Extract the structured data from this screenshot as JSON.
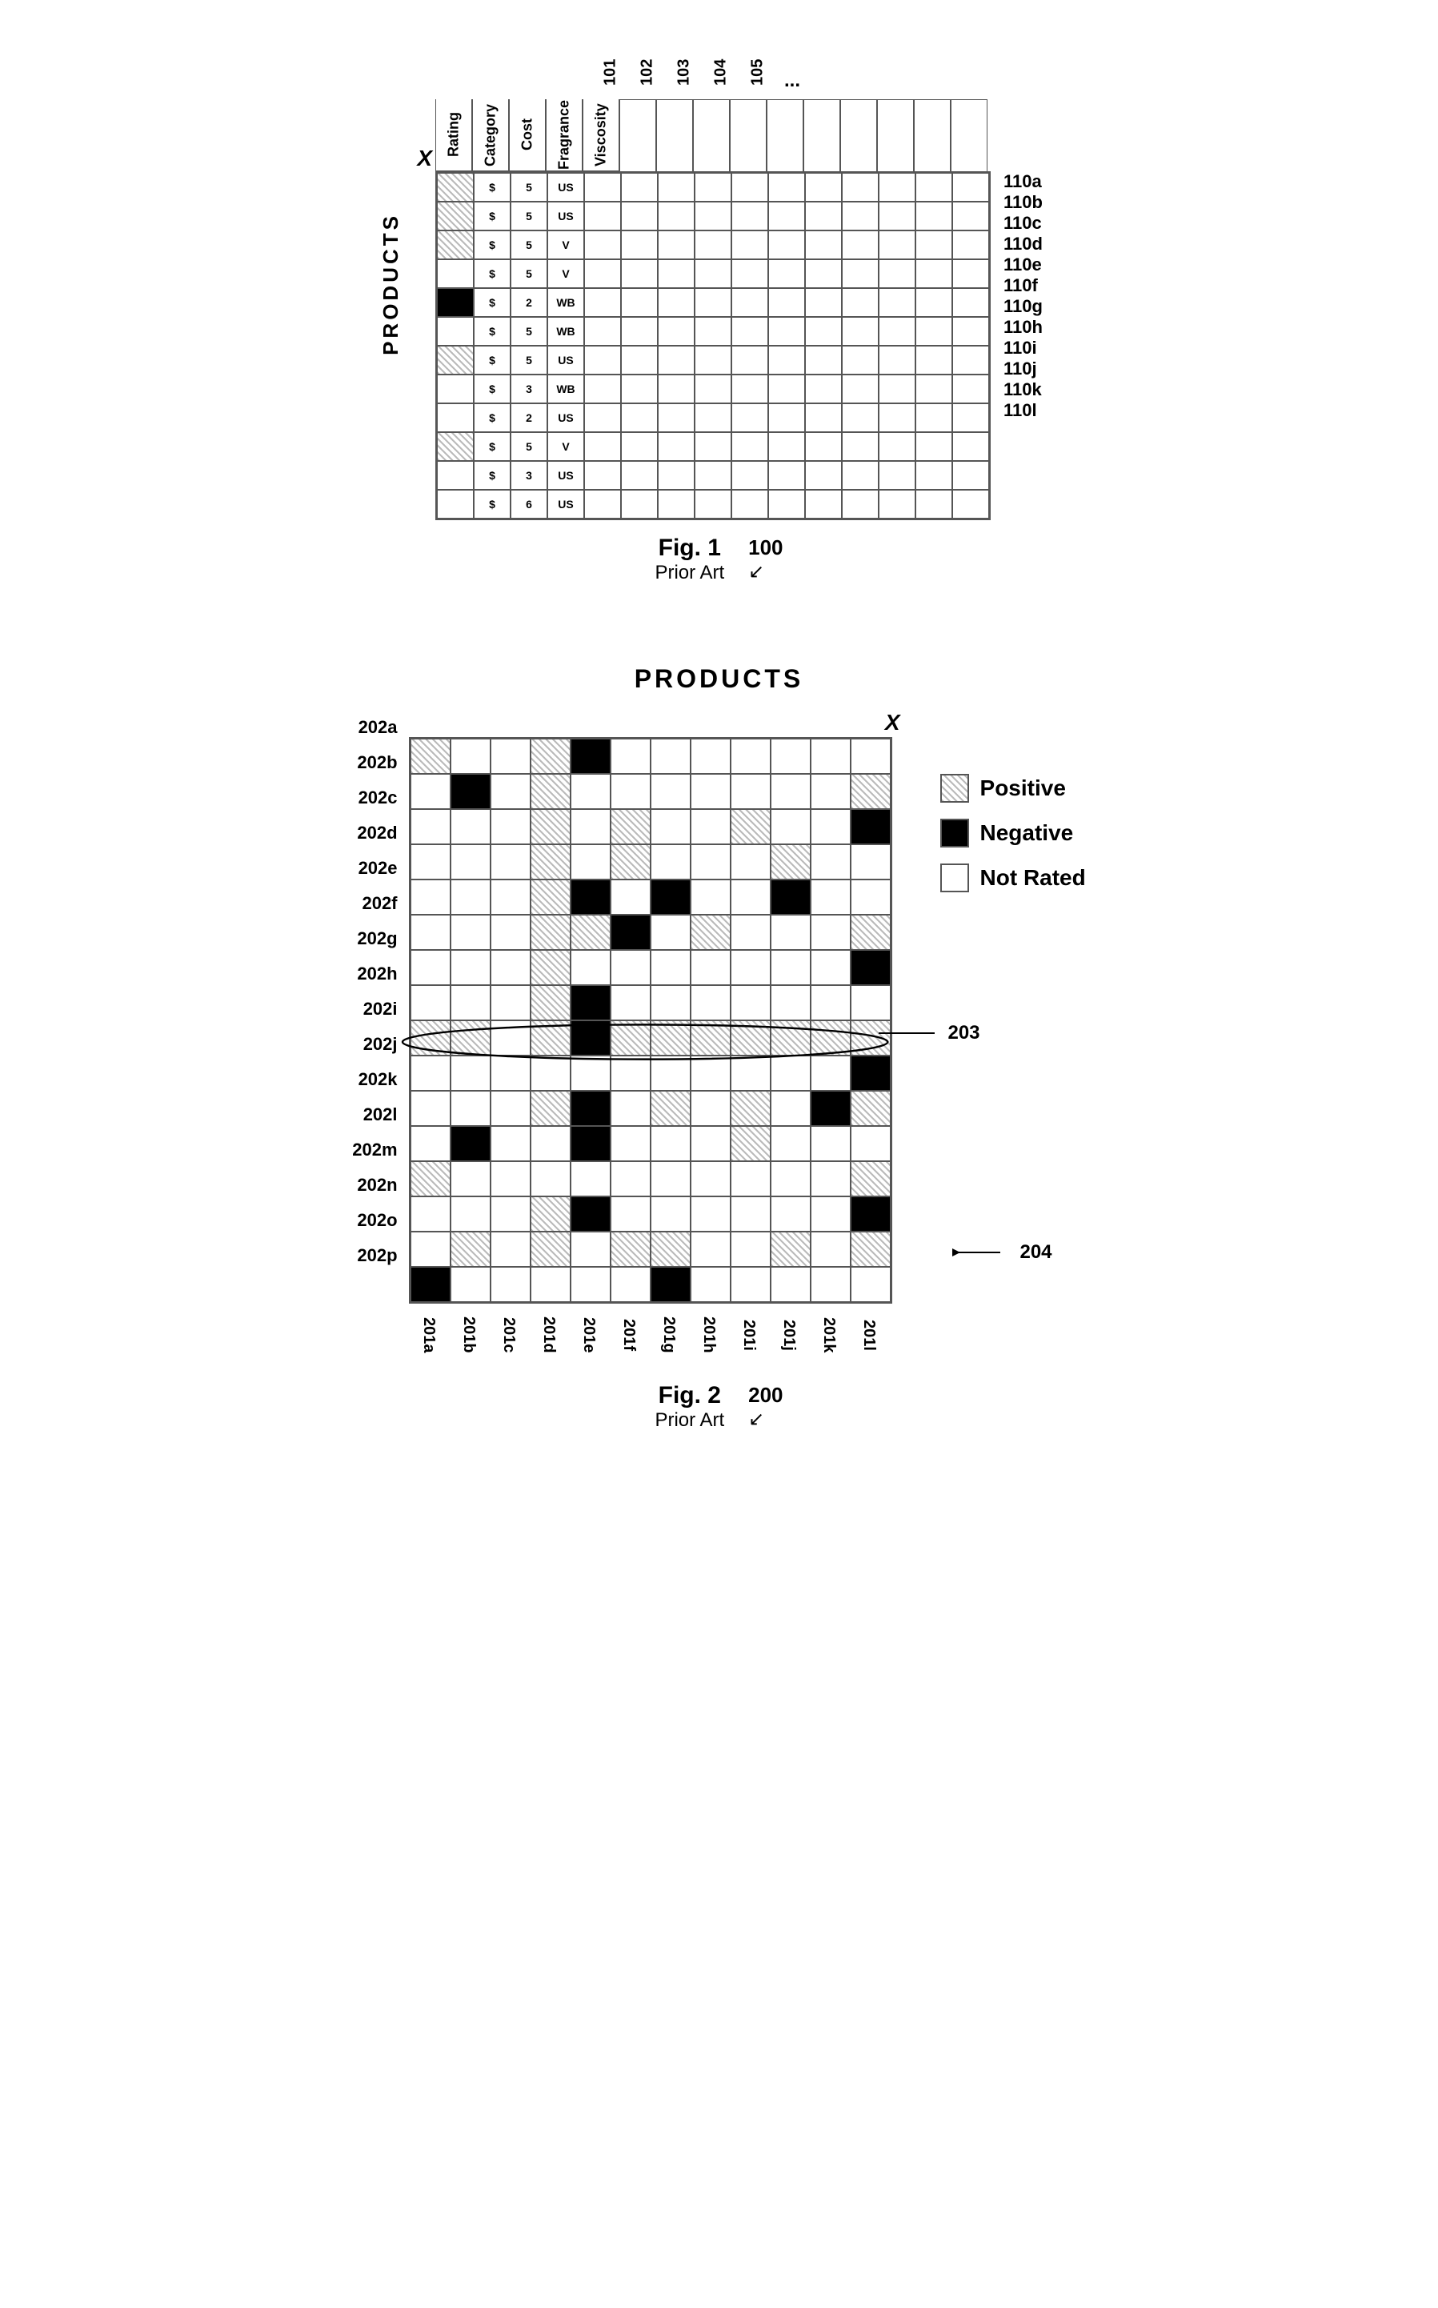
{
  "fig1": {
    "title": "Fig. 1",
    "subtitle": "Prior Art",
    "ref": "100",
    "products_label": "PRODUCTS",
    "x_label": "X",
    "col_numbers": [
      "101",
      "102",
      "103",
      "104",
      "105"
    ],
    "ellipsis": "...",
    "attr_headers": [
      "Rating",
      "Category",
      "Cost",
      "Fragrance",
      "Viscosity"
    ],
    "row_labels": [
      "110a",
      "110b",
      "110c",
      "110d",
      "110e",
      "110f",
      "110g",
      "110h",
      "110i",
      "110j",
      "110k",
      "110l"
    ],
    "rows": [
      [
        "hatched",
        "text",
        "text",
        "text",
        "white",
        "white",
        "white",
        "white",
        "white",
        "white",
        "white",
        "white",
        "white",
        "white",
        "white"
      ],
      [
        "hatched",
        "text",
        "text",
        "text",
        "white",
        "white",
        "white",
        "white",
        "white",
        "white",
        "white",
        "white",
        "white",
        "white",
        "white"
      ],
      [
        "hatched",
        "text",
        "text",
        "text",
        "white",
        "white",
        "white",
        "white",
        "white",
        "white",
        "white",
        "white",
        "white",
        "white",
        "white"
      ],
      [
        "white",
        "text",
        "text",
        "text",
        "white",
        "white",
        "white",
        "white",
        "white",
        "white",
        "white",
        "white",
        "white",
        "white",
        "white"
      ],
      [
        "black",
        "text",
        "text",
        "text",
        "white",
        "white",
        "white",
        "white",
        "white",
        "white",
        "white",
        "white",
        "white",
        "white",
        "white"
      ],
      [
        "white",
        "text",
        "text",
        "text",
        "white",
        "white",
        "white",
        "white",
        "white",
        "white",
        "white",
        "white",
        "white",
        "white",
        "white"
      ],
      [
        "hatched",
        "text",
        "text",
        "text",
        "white",
        "white",
        "white",
        "white",
        "white",
        "white",
        "white",
        "white",
        "white",
        "white",
        "white"
      ],
      [
        "white",
        "text",
        "text",
        "text",
        "white",
        "white",
        "white",
        "white",
        "white",
        "white",
        "white",
        "white",
        "white",
        "white",
        "white"
      ],
      [
        "white",
        "text",
        "text",
        "text",
        "white",
        "white",
        "white",
        "white",
        "white",
        "white",
        "white",
        "white",
        "white",
        "white",
        "white"
      ],
      [
        "hatched",
        "text",
        "text",
        "text",
        "white",
        "white",
        "white",
        "white",
        "white",
        "white",
        "white",
        "white",
        "white",
        "white",
        "white"
      ],
      [
        "white",
        "text",
        "text",
        "text",
        "white",
        "white",
        "white",
        "white",
        "white",
        "white",
        "white",
        "white",
        "white",
        "white",
        "white"
      ],
      [
        "white",
        "text",
        "text",
        "text",
        "white",
        "white",
        "white",
        "white",
        "white",
        "white",
        "white",
        "white",
        "white",
        "white",
        "white"
      ]
    ],
    "cell_texts": [
      [
        "",
        "$",
        "5",
        "US"
      ],
      [
        "",
        "$",
        "5",
        "US"
      ],
      [
        "",
        "$",
        "5",
        "V"
      ],
      [
        "",
        "$",
        "5",
        "V"
      ],
      [
        "",
        "$",
        "2",
        "WB"
      ],
      [
        "",
        "$",
        "5",
        "WB"
      ],
      [
        "",
        "$",
        "5",
        "US"
      ],
      [
        "",
        "$",
        "3",
        "WB"
      ],
      [
        "",
        "$",
        "2",
        "US"
      ],
      [
        "",
        "$",
        "5",
        "V"
      ],
      [
        "",
        "$",
        "3",
        "US"
      ],
      [
        "",
        "$",
        "6",
        "US"
      ]
    ]
  },
  "fig2": {
    "title": "PRODUCTS",
    "fig_title": "Fig. 2",
    "subtitle": "Prior Art",
    "ref": "200",
    "x_label": "X",
    "row_labels": [
      "202a",
      "202b",
      "202c",
      "202d",
      "202e",
      "202f",
      "202g",
      "202h",
      "202i",
      "202j",
      "202k",
      "202l",
      "202m",
      "202n",
      "202o",
      "202p"
    ],
    "col_labels": [
      "201a",
      "201b",
      "201c",
      "201d",
      "201e",
      "201f",
      "201g",
      "201h",
      "201i",
      "201j",
      "201k",
      "201l"
    ],
    "callout_203": "203",
    "callout_204": "204",
    "legend": {
      "positive_label": "Positive",
      "negative_label": "Negative",
      "not_rated_label": "Not Rated"
    },
    "grid": [
      [
        "hatched",
        "white",
        "white",
        "hatched",
        "black",
        "white",
        "white",
        "white",
        "white",
        "white",
        "white",
        "white"
      ],
      [
        "white",
        "black",
        "white",
        "hatched",
        "white",
        "white",
        "white",
        "white",
        "white",
        "white",
        "white",
        "hatched"
      ],
      [
        "white",
        "white",
        "white",
        "hatched",
        "white",
        "hatched",
        "white",
        "white",
        "hatched",
        "white",
        "white",
        "black"
      ],
      [
        "white",
        "white",
        "white",
        "hatched",
        "white",
        "hatched",
        "white",
        "white",
        "white",
        "hatched",
        "white",
        "white"
      ],
      [
        "white",
        "white",
        "white",
        "hatched",
        "black",
        "white",
        "black",
        "white",
        "white",
        "black",
        "white",
        "white"
      ],
      [
        "white",
        "white",
        "white",
        "hatched",
        "hatched",
        "black",
        "white",
        "hatched",
        "white",
        "white",
        "white",
        "hatched"
      ],
      [
        "white",
        "white",
        "white",
        "hatched",
        "white",
        "white",
        "white",
        "white",
        "white",
        "white",
        "white",
        "black"
      ],
      [
        "white",
        "white",
        "white",
        "hatched",
        "black",
        "white",
        "white",
        "white",
        "white",
        "white",
        "white",
        "white"
      ],
      [
        "hatched",
        "hatched",
        "white",
        "hatched",
        "black",
        "hatched",
        "hatched",
        "hatched",
        "hatched",
        "hatched",
        "hatched",
        "hatched"
      ],
      [
        "white",
        "white",
        "white",
        "white",
        "white",
        "white",
        "white",
        "white",
        "white",
        "white",
        "white",
        "black"
      ],
      [
        "white",
        "white",
        "white",
        "hatched",
        "black",
        "white",
        "hatched",
        "white",
        "hatched",
        "white",
        "black",
        "hatched"
      ],
      [
        "white",
        "black",
        "white",
        "white",
        "black",
        "white",
        "white",
        "white",
        "hatched",
        "white",
        "white",
        "white"
      ],
      [
        "hatched",
        "white",
        "white",
        "white",
        "white",
        "white",
        "white",
        "white",
        "white",
        "white",
        "white",
        "hatched"
      ],
      [
        "white",
        "white",
        "white",
        "hatched",
        "black",
        "white",
        "white",
        "white",
        "white",
        "white",
        "white",
        "black"
      ],
      [
        "white",
        "hatched",
        "white",
        "hatched",
        "white",
        "hatched",
        "hatched",
        "white",
        "white",
        "hatched",
        "white",
        "hatched"
      ],
      [
        "black",
        "white",
        "white",
        "white",
        "white",
        "white",
        "black",
        "white",
        "white",
        "white",
        "white",
        "white"
      ]
    ]
  }
}
